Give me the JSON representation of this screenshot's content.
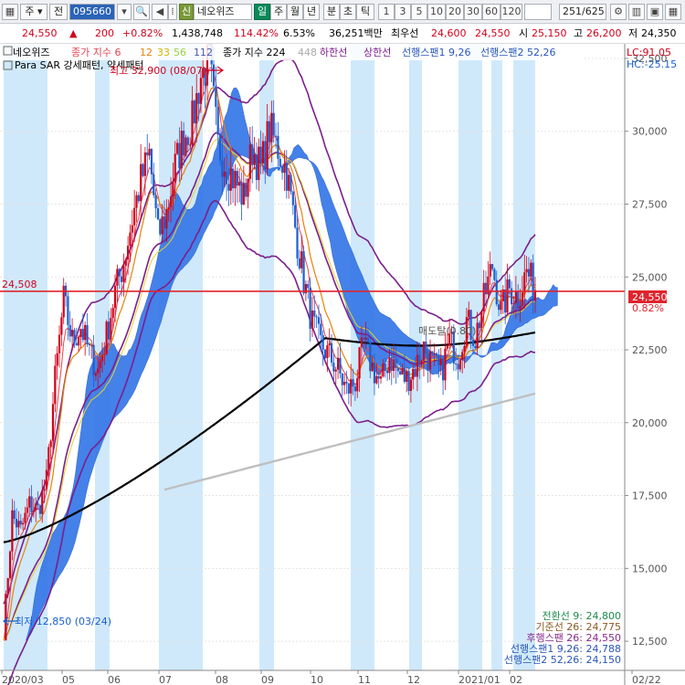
{
  "toolbar": {
    "market": "주",
    "prev_label": "전",
    "code": "095660",
    "stock_tag": "신",
    "stock_name": "네오위즈",
    "period_day": "일",
    "period_week": "주",
    "period_month": "월",
    "period_year": "년",
    "period_min": "분",
    "period_sec": "초",
    "period_tick": "틱",
    "tick_values": [
      "1",
      "3",
      "5",
      "10",
      "20",
      "30",
      "60",
      "120"
    ],
    "page_counter": "251/625"
  },
  "info": {
    "price": "24,550",
    "change_arrow": "▲",
    "change": "200",
    "change_pct": "+0.82%",
    "volume": "1,438,748",
    "volume_ratio": "114.42%",
    "turnover": "6.53%",
    "amount": "36,251백만",
    "best_label": "최우선",
    "best_ask": "24,600",
    "best_bid": "24,550",
    "open_label": "시",
    "open": "25,150",
    "high_label": "고",
    "high": "26,200",
    "low_label": "저",
    "low": "24,350"
  },
  "legend": {
    "name": "네오위즈",
    "ma_label": "종가 지수 6",
    "ma12": "12",
    "ma33": "33",
    "ma56": "56",
    "ma112": "112",
    "ma224_label": "종가 지수 224",
    "ma448": "448",
    "lower": "하한선",
    "upper": "상한선",
    "span1": "선행스팬1 9,26",
    "span2": "선행스팬2 52,26",
    "para": "Para SAR 강세패턴, 약세패턴",
    "lc": "LC:91.05",
    "hc": "HC:-25.15"
  },
  "annotations": {
    "high": "최고 32,900 (08/07)",
    "low": "최저 12,850 (03/24)",
    "hline_value": "24,508",
    "bullish": "매도탈(0.80)"
  },
  "ichimoku_readout": [
    {
      "text": "전환선 9: 24,800",
      "color": "#1f8a4c"
    },
    {
      "text": "기준선 26: 24,775",
      "color": "#8a5a1f"
    },
    {
      "text": "후행스팬 26: 24,550",
      "color": "#8a2a8a"
    },
    {
      "text": "선행스팬1 9,26: 24,788",
      "color": "#2a55b8"
    },
    {
      "text": "선행스팬2 52,26: 24,150",
      "color": "#2a55b8"
    }
  ],
  "price_tag": {
    "price": "24,550",
    "pct": "0.82%",
    "color": "#e0242e"
  },
  "colors": {
    "up": "#d0021b",
    "down": "#1b5fd1",
    "cloud": "#3a7be8",
    "band": "#7b1e8c",
    "ma224": "#000000",
    "ma448": "#bfbfbf",
    "ma12": "#e8820c",
    "ma33": "#e8d22a",
    "stripe": "#cfe9fb"
  },
  "chart_data": {
    "type": "line",
    "series_type": "candlestick",
    "title": "네오위즈",
    "ylim": [
      11500,
      33000
    ],
    "y_ticks": [
      12500,
      15000,
      17500,
      20000,
      22500,
      25000,
      27500,
      30000,
      32500
    ],
    "y_tick_labels": [
      "12,500",
      "15,000",
      "17,500",
      "20,000",
      "22,500",
      "25,000",
      "27,500",
      "30,000",
      "32,500"
    ],
    "x_labels": [
      "2020/03",
      "05",
      "06",
      "07",
      "08",
      "09",
      "10",
      "11",
      "12",
      "2021/01",
      "02",
      "02/22"
    ],
    "price_path": [
      [
        0,
        12850
      ],
      [
        4,
        16800
      ],
      [
        8,
        16300
      ],
      [
        12,
        17200
      ],
      [
        16,
        17000
      ],
      [
        20,
        18000
      ],
      [
        24,
        21500
      ],
      [
        28,
        24200
      ],
      [
        32,
        22800
      ],
      [
        36,
        23300
      ],
      [
        40,
        22400
      ],
      [
        44,
        21800
      ],
      [
        48,
        23000
      ],
      [
        52,
        24500
      ],
      [
        56,
        25500
      ],
      [
        60,
        27000
      ],
      [
        64,
        28300
      ],
      [
        68,
        29200
      ],
      [
        72,
        26400
      ],
      [
        76,
        27200
      ],
      [
        80,
        28800
      ],
      [
        84,
        29800
      ],
      [
        88,
        30300
      ],
      [
        92,
        31900
      ],
      [
        96,
        32400
      ],
      [
        100,
        29500
      ],
      [
        104,
        28800
      ],
      [
        108,
        28300
      ],
      [
        112,
        27700
      ],
      [
        116,
        29400
      ],
      [
        120,
        28700
      ],
      [
        124,
        30100
      ],
      [
        128,
        29400
      ],
      [
        132,
        28600
      ],
      [
        136,
        26700
      ],
      [
        140,
        24900
      ],
      [
        144,
        23400
      ],
      [
        148,
        22700
      ],
      [
        152,
        22300
      ],
      [
        156,
        21800
      ],
      [
        160,
        21100
      ],
      [
        164,
        21400
      ],
      [
        168,
        22700
      ],
      [
        172,
        21900
      ],
      [
        176,
        21300
      ],
      [
        180,
        22300
      ],
      [
        184,
        21700
      ],
      [
        188,
        21500
      ],
      [
        192,
        21900
      ],
      [
        196,
        22600
      ],
      [
        200,
        22000
      ],
      [
        204,
        21700
      ],
      [
        208,
        22800
      ],
      [
        212,
        22300
      ],
      [
        216,
        23500
      ],
      [
        220,
        22900
      ],
      [
        224,
        24200
      ],
      [
        228,
        25400
      ],
      [
        232,
        23800
      ],
      [
        236,
        24600
      ],
      [
        240,
        24300
      ],
      [
        244,
        25200
      ],
      [
        248,
        24550
      ]
    ],
    "hline": 24508
  }
}
